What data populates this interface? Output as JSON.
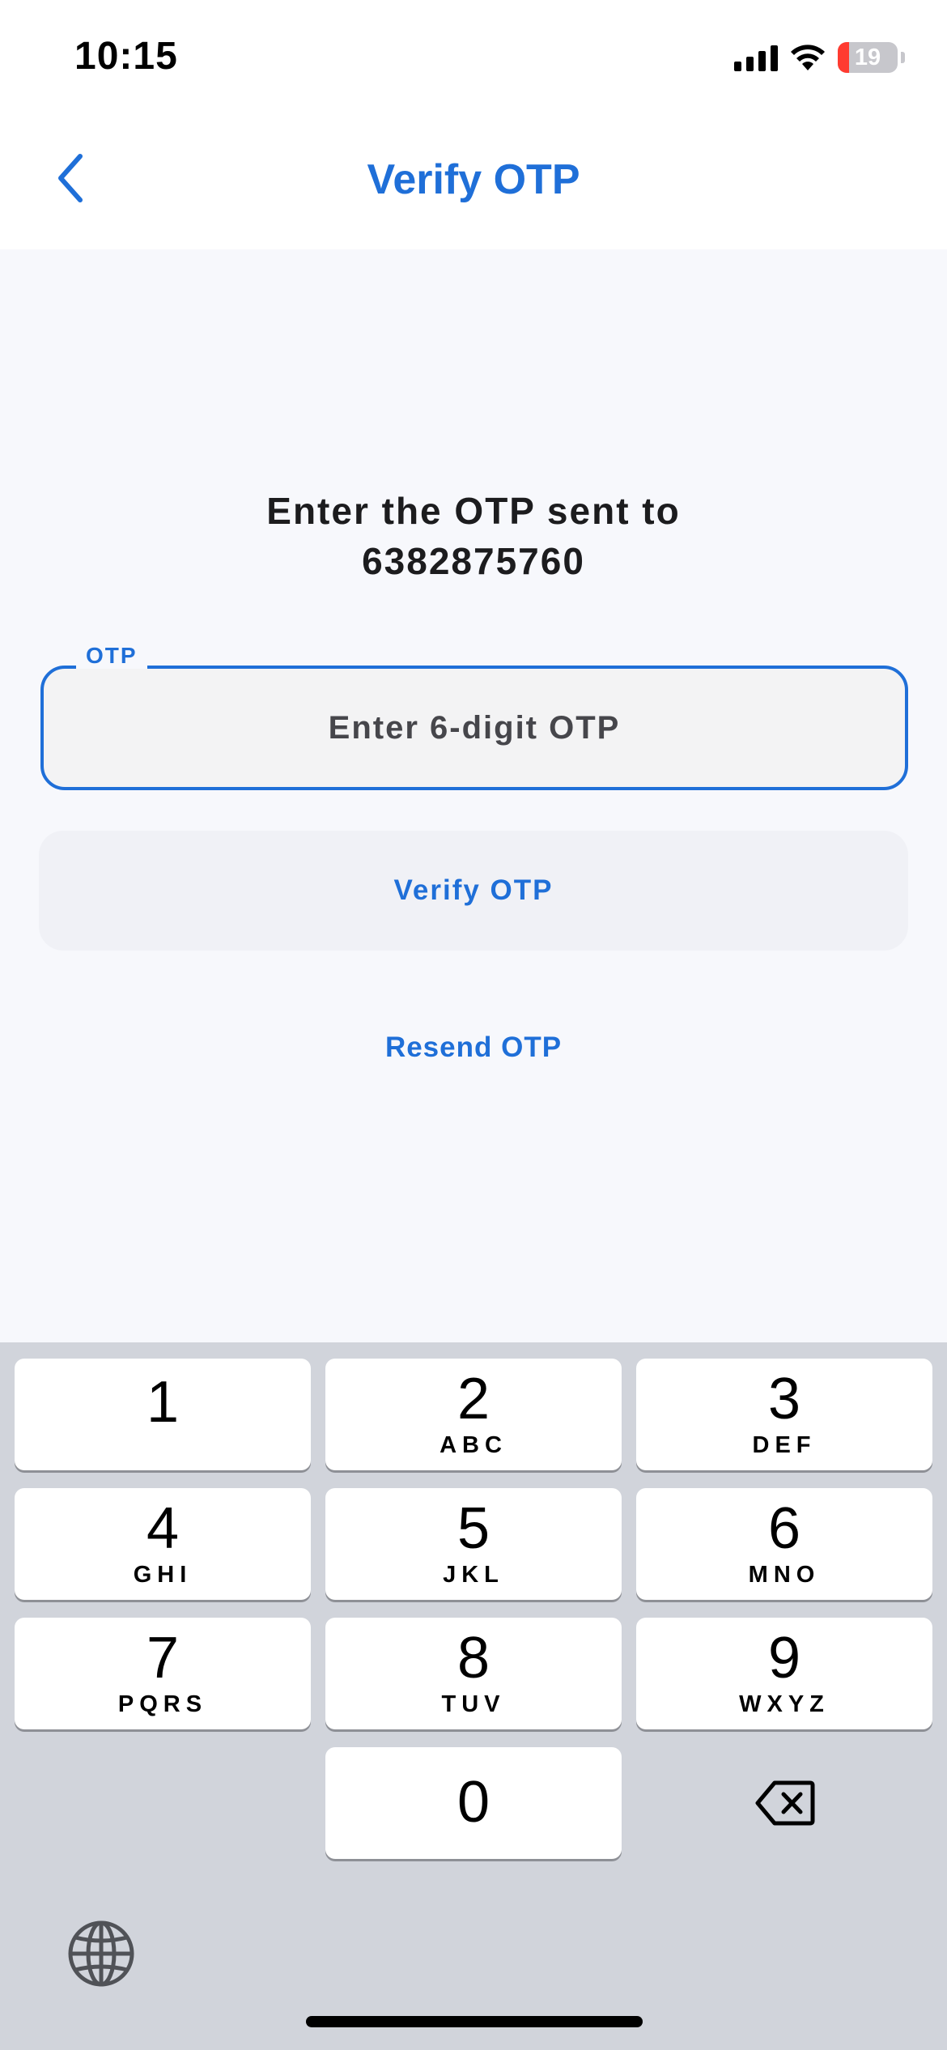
{
  "status_bar": {
    "time": "10:15",
    "battery_level": "19",
    "icons": [
      "cellular-signal-icon",
      "wifi-icon",
      "battery-icon"
    ]
  },
  "nav": {
    "back_icon": "chevron-left-icon",
    "title": "Verify OTP"
  },
  "main": {
    "prompt_line1": "Enter the OTP sent to",
    "prompt_line2": "6382875760",
    "otp_field": {
      "label": "OTP",
      "value": "",
      "placeholder": "Enter 6-digit OTP"
    },
    "verify_button_label": "Verify OTP",
    "resend_label": "Resend OTP"
  },
  "keyboard": {
    "keys": [
      {
        "digit": "1",
        "letters": ""
      },
      {
        "digit": "2",
        "letters": "ABC"
      },
      {
        "digit": "3",
        "letters": "DEF"
      },
      {
        "digit": "4",
        "letters": "GHI"
      },
      {
        "digit": "5",
        "letters": "JKL"
      },
      {
        "digit": "6",
        "letters": "MNO"
      },
      {
        "digit": "7",
        "letters": "PQRS"
      },
      {
        "digit": "8",
        "letters": "TUV"
      },
      {
        "digit": "9",
        "letters": "WXYZ"
      },
      {
        "digit": "0",
        "letters": ""
      }
    ],
    "delete_icon": "backspace-icon",
    "globe_icon": "globe-icon"
  },
  "colors": {
    "accent": "#1f6fd8",
    "background": "#f7f8fc",
    "keyboard_background": "#d1d4db",
    "battery_low": "#ff3b30"
  }
}
